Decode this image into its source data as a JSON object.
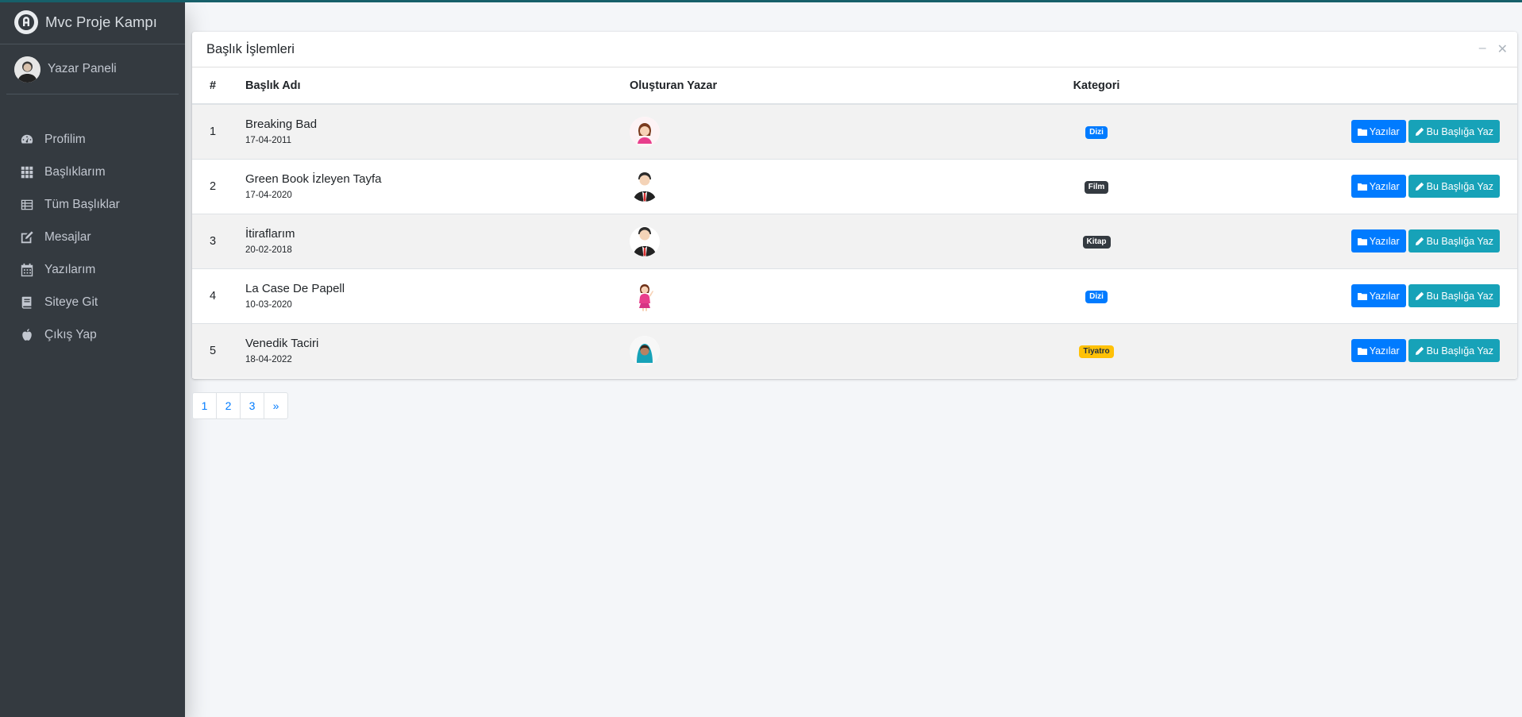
{
  "brand": {
    "title": "Mvc Proje Kampı"
  },
  "user": {
    "name": "Yazar Paneli"
  },
  "sidebar": {
    "items": [
      {
        "label": "Profilim",
        "icon": "tachometer-icon"
      },
      {
        "label": "Başlıklarım",
        "icon": "grid-icon"
      },
      {
        "label": "Tüm Başlıklar",
        "icon": "list-icon"
      },
      {
        "label": "Mesajlar",
        "icon": "edit-icon"
      },
      {
        "label": "Yazılarım",
        "icon": "calendar-icon"
      },
      {
        "label": "Siteye Git",
        "icon": "book-icon"
      },
      {
        "label": "Çıkış Yap",
        "icon": "apple-icon"
      }
    ]
  },
  "card": {
    "title": "Başlık İşlemleri",
    "columns": [
      "#",
      "Başlık Adı",
      "Oluşturan Yazar",
      "Kategori"
    ],
    "rows": [
      {
        "num": "1",
        "title": "Breaking Bad",
        "date": "17-04-2011",
        "author_icon": "woman-avatar-icon",
        "category": "Dizi",
        "category_color": "#007bff"
      },
      {
        "num": "2",
        "title": "Green Book İzleyen Tayfa",
        "date": "17-04-2020",
        "author_icon": "man-suit-avatar-icon",
        "category": "Film",
        "category_color": "#343a40"
      },
      {
        "num": "3",
        "title": "İtiraflarım",
        "date": "20-02-2018",
        "author_icon": "man-suit-avatar-icon",
        "category": "Kitap",
        "category_color": "#343a40"
      },
      {
        "num": "4",
        "title": "La Case De Papell",
        "date": "10-03-2020",
        "author_icon": "woman-waving-avatar-icon",
        "category": "Dizi",
        "category_color": "#007bff"
      },
      {
        "num": "5",
        "title": "Venedik Taciri",
        "date": "18-04-2022",
        "author_icon": "woman-hijab-avatar-icon",
        "category": "Tiyatro",
        "category_color": "#ffc107"
      }
    ],
    "buttons": {
      "posts_label": "Yazılar",
      "write_label": "Bu Başlığa Yaz"
    }
  },
  "pagination": {
    "pages": [
      "1",
      "2",
      "3"
    ],
    "next": "»"
  },
  "colors": {
    "sidebar_bg": "#343a40",
    "primary": "#007bff",
    "info": "#17a2b8",
    "top_accent": "#17606a"
  }
}
